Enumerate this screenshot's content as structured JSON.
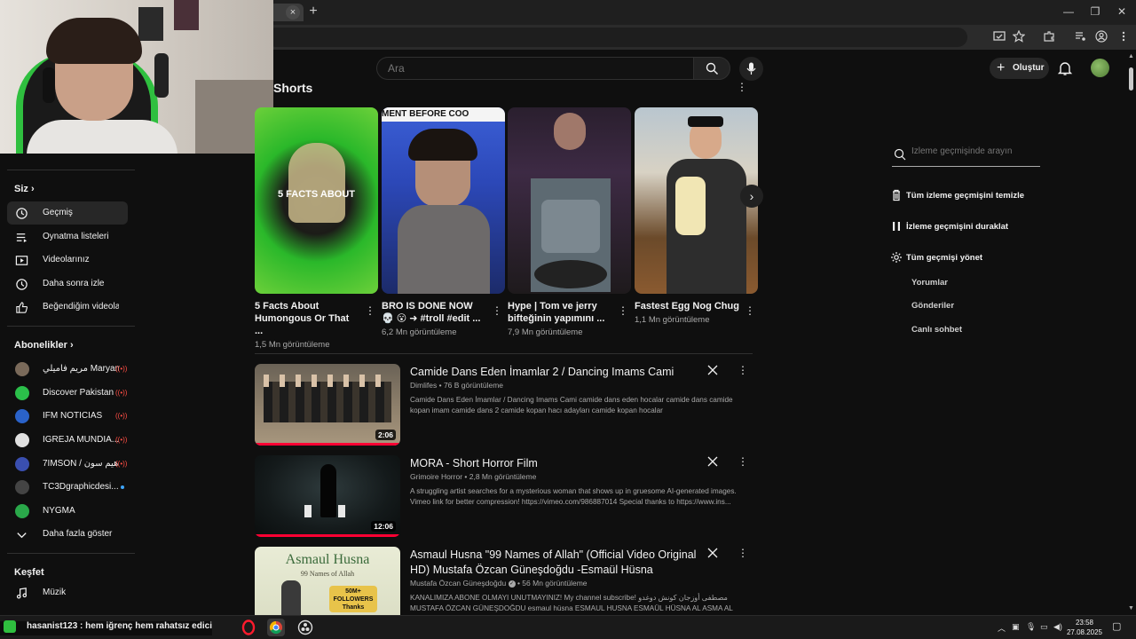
{
  "browser": {
    "tab_add": "+",
    "tab_close": "×",
    "window": {
      "minimize": "—",
      "restore": "❐",
      "close": "✕"
    }
  },
  "header": {
    "search_placeholder": "Ara",
    "create_label": "Oluştur"
  },
  "sidebar": {
    "you_section": "Siz",
    "you_items": [
      {
        "label": "Geçmiş",
        "icon": "history-icon",
        "active": true
      },
      {
        "label": "Oynatma listeleri",
        "icon": "playlist-icon"
      },
      {
        "label": "Videolarınız",
        "icon": "your-videos-icon"
      },
      {
        "label": "Daha sonra izle",
        "icon": "watch-later-icon"
      },
      {
        "label": "Beğendiğim videolar",
        "icon": "liked-icon"
      }
    ],
    "subs_section": "Abonelikler",
    "subs": [
      {
        "label": "مريم فاميلي Maryam ...",
        "color": "#7a6a5a",
        "live": true
      },
      {
        "label": "Discover Pakistan",
        "color": "#2bbf4a",
        "live": true
      },
      {
        "label": "IFM NOTICIAS",
        "color": "#2a62c9",
        "live": true
      },
      {
        "label": "IGREJA MUNDIA...",
        "color": "#e0e0e0",
        "live": true
      },
      {
        "label": "7IMSON / هيم سون",
        "color": "#3a4fb0",
        "live": true
      },
      {
        "label": "TC3Dgraphicdesi...",
        "color": "#444444",
        "dot": true
      },
      {
        "label": "NYGMA",
        "color": "#2aa84a"
      }
    ],
    "show_more": "Daha fazla göster",
    "explore_section": "Keşfet",
    "explore_items": [
      {
        "label": "Müzik",
        "icon": "music-icon"
      }
    ]
  },
  "shorts": {
    "title": "Shorts",
    "items": [
      {
        "title": "5 Facts About Humongous Or That ...",
        "views": "1,5 Mn görüntüleme",
        "thumb_text": "5 FACTS ABOUT"
      },
      {
        "title": "BRO IS DONE NOW 💀 😮 ➜ #troll #edit ...",
        "views": "6,2 Mn görüntüleme",
        "thumb_text": "MENT BEFORE COO"
      },
      {
        "title": "Hype | Tom ve jerry bifteğinin yapımını ...",
        "views": "7,9 Mn görüntüleme"
      },
      {
        "title": "Fastest Egg Nog Chug",
        "views": "1,1 Mn görüntüleme"
      }
    ]
  },
  "videos": [
    {
      "title": "Camide Dans Eden İmamlar 2 / Dancing Imams Cami",
      "channel": "Dimlifes",
      "views": "76 B görüntüleme",
      "description": "Camide Dans Eden İmamlar / Dancing Imams Cami camide dans eden hocalar camide dans camide kopan imam camide dans 2 camide kopan hacı adayları camide kopan hocalar",
      "duration": "2:06",
      "verified": false
    },
    {
      "title": "MORA - Short Horror Film",
      "channel": "Grimoire Horror",
      "views": "2,8 Mn görüntüleme",
      "description": "A struggling artist searches for a mysterious woman that shows up in gruesome AI-generated images. Vimeo link for better compression! https://vimeo.com/986887014 Special thanks to https://www.ins...",
      "duration": "12:06",
      "verified": false
    },
    {
      "title": "Asmaul Husna \"99 Names of Allah\" (Official Video Original HD) Mustafa Özcan Güneşdoğdu -Esmaül Hüsna",
      "channel": "Mustafa Özcan Güneşdoğdu",
      "views": "56 Mn görüntüleme",
      "description": "KANALIMIZA ABONE OLMAYI UNUTMAYINIZ! My channel subscribe! مصطفى أوزجان كونش دوغدو MUSTAFA ÖZCAN GÜNEŞDOĞDU esmaul hüsna ESMAUL HUSNA ESMAÜL HÜSNA AL ASMA AL HUSNA...",
      "duration": "",
      "verified": true,
      "thumb_text": "Asmaul Husna",
      "thumb_sub": "99 Names of Allah",
      "thumb_badge": "50M+ FOLLOWERS Thanks"
    }
  ],
  "history_panel": {
    "search_placeholder": "İzleme geçmişinde arayın",
    "clear_all": "Tüm izleme geçmişini temizle",
    "pause": "İzleme geçmişini duraklat",
    "manage": "Tüm geçmişi yönet",
    "sub_items": [
      "Yorumlar",
      "Gönderiler",
      "Canlı sohbet"
    ]
  },
  "taskbar": {
    "chat_overlay": "hasanist123 : hem iğrenç hem rahatsız edici",
    "time": "23:58",
    "date": "27.08.2025"
  }
}
